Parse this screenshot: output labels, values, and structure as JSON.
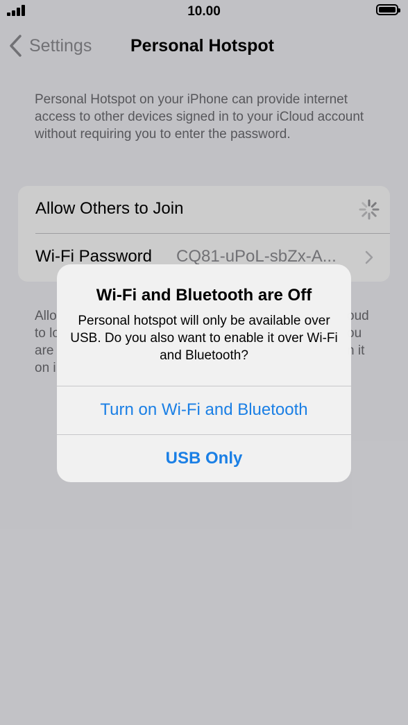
{
  "status_bar": {
    "time": "10.00"
  },
  "nav": {
    "back_label": "Settings",
    "title": "Personal Hotspot"
  },
  "description": "Personal Hotspot on your iPhone can provide internet access to other devices signed in to your iCloud account without requiring you to enter the password.",
  "settings": {
    "allow_others_label": "Allow Others to Join",
    "wifi_password_label": "Wi-Fi Password",
    "wifi_password_value": "CQ81-uPoL-sbZx-A..."
  },
  "footer_partial": [
    "Allo",
    "to lo",
    "are",
    "on i"
  ],
  "footer_partial_right": [
    "oud",
    "ou",
    "n it"
  ],
  "alert": {
    "title": "Wi-Fi and Bluetooth are Off",
    "message": "Personal hotspot will only be available over USB. Do you also want to enable it over Wi-Fi and Bluetooth?",
    "primary_button": "Turn on Wi-Fi and Bluetooth",
    "secondary_button": "USB Only"
  },
  "colors": {
    "accent": "#1a7fe5",
    "secondary_text": "#8e8e93",
    "background": "#f2f2f7"
  },
  "icons": {
    "back": "chevron-left-icon",
    "spinner": "activity-spinner-icon",
    "disclosure": "chevron-right-icon",
    "signal": "cellular-signal-icon",
    "battery": "battery-icon"
  }
}
